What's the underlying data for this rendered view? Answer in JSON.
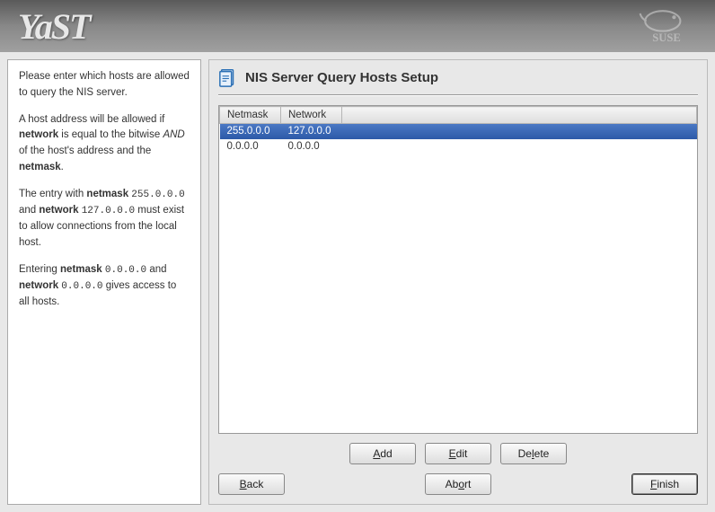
{
  "branding": {
    "app": "YaST",
    "vendor": "SUSE"
  },
  "help": {
    "p1_a": "Please enter which hosts are allowed to query the NIS server.",
    "p2_a": "A host address will be allowed if ",
    "p2_net": "network",
    "p2_b": " is equal to the bitwise ",
    "p2_and": "AND",
    "p2_c": " of the host's address and the ",
    "p2_mask": "netmask",
    "p2_d": ".",
    "p3_a": "The entry with ",
    "p3_mask": "netmask",
    "p3_b": " ",
    "p3_maskv": "255.0.0.0",
    "p3_c": " and ",
    "p3_net": "network",
    "p3_d": " ",
    "p3_netv": "127.0.0.0",
    "p3_e": " must exist to allow connections from the local host.",
    "p4_a": "Entering ",
    "p4_mask": "netmask",
    "p4_b": " ",
    "p4_maskv": "0.0.0.0",
    "p4_c": " and ",
    "p4_net": "network",
    "p4_d": " ",
    "p4_netv": "0.0.0.0",
    "p4_e": " gives access to all hosts."
  },
  "content": {
    "title": "NIS Server Query Hosts Setup",
    "table": {
      "headers": {
        "netmask": "Netmask",
        "network": "Network"
      },
      "rows": [
        {
          "netmask": "255.0.0.0",
          "network": "127.0.0.0",
          "selected": true
        },
        {
          "netmask": "0.0.0.0",
          "network": "0.0.0.0",
          "selected": false
        }
      ]
    },
    "buttons": {
      "add_pre": "A",
      "add_rest": "dd",
      "edit_pre": "",
      "edit_mn": "E",
      "edit_rest": "dit",
      "del_pre": "De",
      "del_mn": "l",
      "del_rest": "ete",
      "back_pre": "",
      "back_mn": "B",
      "back_rest": "ack",
      "abort_pre": "Ab",
      "abort_mn": "o",
      "abort_rest": "rt",
      "finish_pre": "",
      "finish_mn": "F",
      "finish_rest": "inish"
    }
  }
}
